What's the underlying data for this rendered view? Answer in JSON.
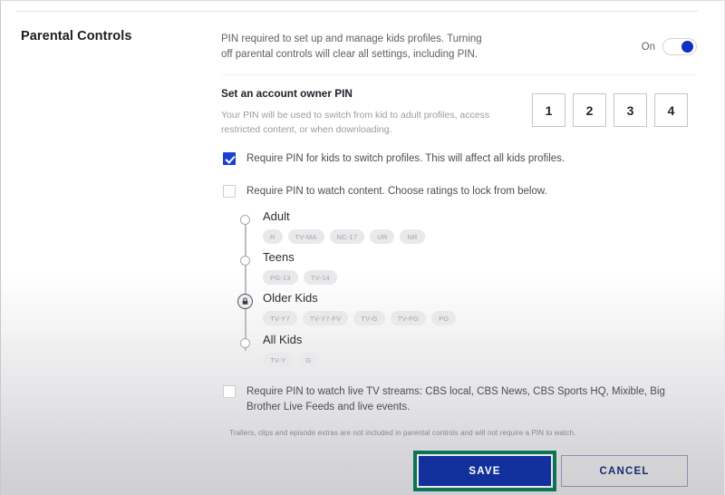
{
  "page": {
    "title": "Parental Controls",
    "intro": "PIN required to set up and manage kids profiles. Turning off parental controls will clear all settings, including PIN.",
    "footnote": "Trailers, clips and episode extras are not included in parental controls and will not require a PIN to watch."
  },
  "toggle": {
    "label": "On",
    "state": "on",
    "knob_color": "#1030c0"
  },
  "pin": {
    "title": "Set an account owner PIN",
    "description": "Your PIN will be used to switch from kid to adult profiles, access restricted content, or when downloading.",
    "digits": [
      "1",
      "2",
      "3",
      "4"
    ]
  },
  "checkboxes": [
    {
      "id": "switch-profiles",
      "label": "Require PIN for kids to switch profiles. This will affect all kids profiles.",
      "checked": true
    },
    {
      "id": "watch-content",
      "label": "Require PIN to watch content. Choose ratings to lock from below.",
      "checked": false
    },
    {
      "id": "live-tv",
      "label": "Require PIN to watch live TV streams: CBS local, CBS News, CBS Sports HQ, Mixible, Big Brother Live Feeds and live events.",
      "checked": false
    }
  ],
  "ratings": {
    "selected_group": "Older Kids",
    "handle_icon": "lock-icon",
    "groups": [
      {
        "name": "Adult",
        "chips": [
          "R",
          "TV-MA",
          "NC-17",
          "UR",
          "NR"
        ]
      },
      {
        "name": "Teens",
        "chips": [
          "PG-13",
          "TV-14"
        ]
      },
      {
        "name": "Older Kids",
        "chips": [
          "TV-Y7",
          "TV-Y7-FV",
          "TV-G",
          "TV-PG",
          "PG"
        ]
      },
      {
        "name": "All Kids",
        "chips": [
          "TV-Y",
          "G"
        ]
      }
    ]
  },
  "footer": {
    "save_label": "SAVE",
    "cancel_label": "CANCEL",
    "save_color": "#12309c",
    "highlight_color": "#0d7357"
  }
}
